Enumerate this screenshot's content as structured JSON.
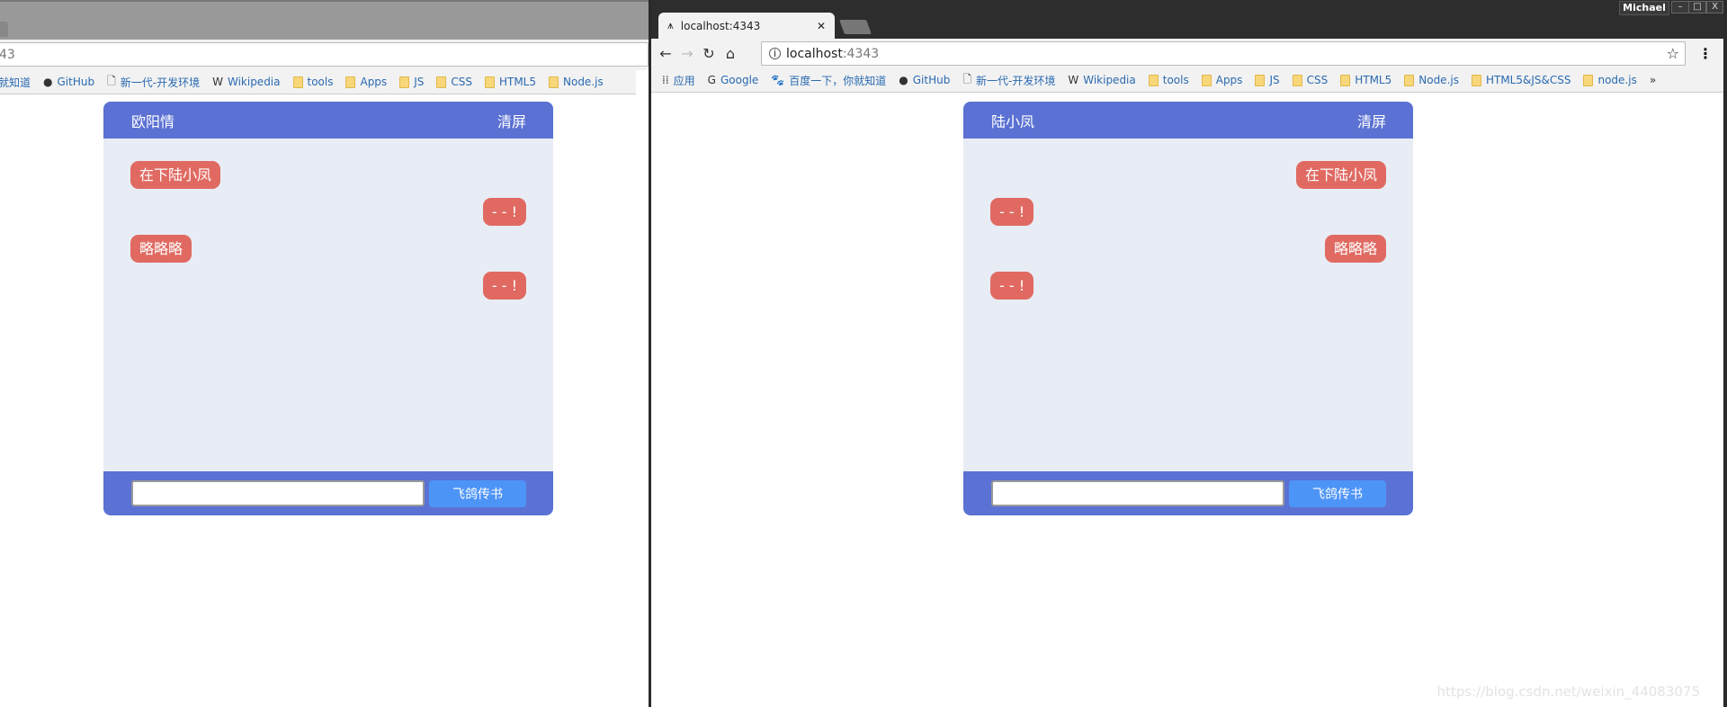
{
  "left_window": {
    "address_partial": "43",
    "bookmarks": [
      {
        "label": "你就知道",
        "icon": "none"
      },
      {
        "label": "GitHub",
        "icon": "github-icon"
      },
      {
        "label": "新一代-开发环境",
        "icon": "page-icon"
      },
      {
        "label": "Wikipedia",
        "icon": "wikipedia-icon"
      },
      {
        "label": "tools",
        "icon": "folder-icon"
      },
      {
        "label": "Apps",
        "icon": "folder-icon"
      },
      {
        "label": "JS",
        "icon": "folder-icon"
      },
      {
        "label": "CSS",
        "icon": "folder-icon"
      },
      {
        "label": "HTML5",
        "icon": "folder-icon"
      },
      {
        "label": "Node.js",
        "icon": "folder-icon"
      }
    ],
    "chat": {
      "user": "欧阳情",
      "clear": "清屏",
      "send": "飞鸽传书",
      "input_value": "",
      "messages": [
        {
          "text": "在下陆小凤",
          "side": "left"
        },
        {
          "text": "- - !",
          "side": "right"
        },
        {
          "text": "略略略",
          "side": "left"
        },
        {
          "text": "- - !",
          "side": "right"
        }
      ]
    }
  },
  "right_window": {
    "tab_title": "localhost:4343",
    "profile": "Michael",
    "window_controls": [
      "–",
      "□",
      "X"
    ],
    "address_host": "localhost",
    "address_port": ":4343",
    "bookmarks": [
      {
        "label": "应用",
        "icon": "apps-icon"
      },
      {
        "label": "Google",
        "icon": "google-icon"
      },
      {
        "label": "百度一下，你就知道",
        "icon": "baidu-icon"
      },
      {
        "label": "GitHub",
        "icon": "github-icon"
      },
      {
        "label": "新一代-开发环境",
        "icon": "page-icon"
      },
      {
        "label": "Wikipedia",
        "icon": "wikipedia-icon"
      },
      {
        "label": "tools",
        "icon": "folder-icon"
      },
      {
        "label": "Apps",
        "icon": "folder-icon"
      },
      {
        "label": "JS",
        "icon": "folder-icon"
      },
      {
        "label": "CSS",
        "icon": "folder-icon"
      },
      {
        "label": "HTML5",
        "icon": "folder-icon"
      },
      {
        "label": "Node.js",
        "icon": "folder-icon"
      },
      {
        "label": "HTML5&JS&CSS",
        "icon": "folder-icon"
      },
      {
        "label": "node.js",
        "icon": "folder-icon"
      }
    ],
    "overflow": "»",
    "chat": {
      "user": "陆小凤",
      "clear": "清屏",
      "send": "飞鸽传书",
      "input_value": "",
      "messages": [
        {
          "text": "在下陆小凤",
          "side": "right"
        },
        {
          "text": "- - !",
          "side": "left"
        },
        {
          "text": "略略略",
          "side": "right"
        },
        {
          "text": "- - !",
          "side": "left"
        }
      ]
    }
  },
  "watermark": "https://blog.csdn.net/weixin_44083075",
  "colors": {
    "header": "#5b71d3",
    "bubble": "#e06a62",
    "send_button": "#4d94f7",
    "chat_bg": "#e8edf5"
  }
}
